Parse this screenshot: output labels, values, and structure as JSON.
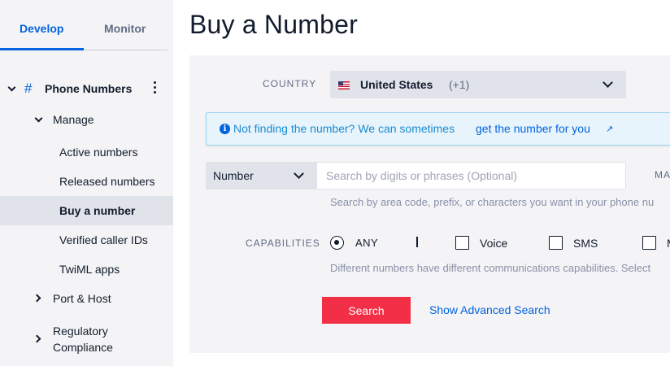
{
  "sidebar": {
    "tabs": [
      {
        "label": "Develop",
        "active": true
      },
      {
        "label": "Monitor",
        "active": false
      }
    ],
    "section": {
      "label": "Phone Numbers",
      "icon": "hash-icon"
    },
    "manage": {
      "label": "Manage"
    },
    "items": [
      {
        "label": "Active numbers"
      },
      {
        "label": "Released numbers"
      },
      {
        "label": "Buy a number",
        "active": true
      },
      {
        "label": "Verified caller IDs"
      },
      {
        "label": "TwiML apps"
      }
    ],
    "port_host": {
      "label": "Port & Host"
    },
    "regulatory": {
      "line1": "Regulatory",
      "line2": "Compliance"
    }
  },
  "main": {
    "title": "Buy a Number",
    "country": {
      "label": "COUNTRY",
      "value": "United States",
      "code": "(+1)",
      "flag_icon": "us-flag-icon"
    },
    "banner": {
      "text": "Not finding the number? We can sometimes",
      "link": "get the number for you",
      "icon": "info-icon",
      "link_icon": "↗"
    },
    "search": {
      "type_value": "Number",
      "placeholder": "Search by digits or phrases (Optional)",
      "match_label": "MA",
      "help": "Search by area code, prefix, or characters you want in your phone nu"
    },
    "capabilities": {
      "label": "CAPABILITIES",
      "any_label": "ANY",
      "any_selected": true,
      "options": [
        "Voice",
        "SMS",
        "M"
      ],
      "help": "Different numbers have different communications capabilities. Select"
    },
    "search_button": "Search",
    "advanced_link": "Show Advanced Search"
  },
  "colors": {
    "accent": "#0263e0",
    "search_button": "#f22f46",
    "banner_bg": "#e8f4fb",
    "sidebar_bg": "#f4f4f6"
  }
}
